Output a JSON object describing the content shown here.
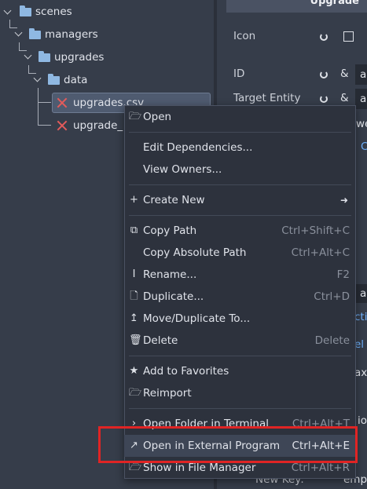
{
  "tree": {
    "items": [
      {
        "label": "scenes"
      },
      {
        "label": "managers"
      },
      {
        "label": "upgrades"
      },
      {
        "label": "data"
      },
      {
        "label": "upgrades.csv"
      },
      {
        "label": "upgrade_"
      }
    ]
  },
  "inspector": {
    "header": "Upgrade",
    "fields": [
      {
        "label": "Icon"
      },
      {
        "label": "ID",
        "value": "a"
      },
      {
        "label": "Target Entity",
        "value": "a"
      }
    ],
    "fragments": [
      "we",
      "C",
      "a",
      "ctio",
      "el",
      "ax",
      "io",
      "New Key:",
      "emp"
    ]
  },
  "menu": {
    "items": [
      {
        "label": "Open",
        "shortcut": "",
        "icon": "folder-open-icon"
      },
      {
        "label": "Edit Dependencies...",
        "shortcut": "",
        "icon": ""
      },
      {
        "label": "View Owners...",
        "shortcut": "",
        "icon": ""
      },
      {
        "label": "Create New",
        "shortcut": "",
        "icon": "plus-icon"
      },
      {
        "label": "Copy Path",
        "shortcut": "Ctrl+Shift+C",
        "icon": "copy-icon"
      },
      {
        "label": "Copy Absolute Path",
        "shortcut": "Ctrl+Alt+C",
        "icon": ""
      },
      {
        "label": "Rename...",
        "shortcut": "F2",
        "icon": "rename-icon"
      },
      {
        "label": "Duplicate...",
        "shortcut": "Ctrl+D",
        "icon": "duplicate-icon"
      },
      {
        "label": "Move/Duplicate To...",
        "shortcut": "",
        "icon": "move-icon"
      },
      {
        "label": "Delete",
        "shortcut": "Delete",
        "icon": "trash-icon"
      },
      {
        "label": "Add to Favorites",
        "shortcut": "",
        "icon": "star-icon"
      },
      {
        "label": "Reimport",
        "shortcut": "",
        "icon": "reimport-icon"
      },
      {
        "label": "Open Folder in Terminal",
        "shortcut": "Ctrl+Alt+T",
        "icon": "terminal-icon"
      },
      {
        "label": "Open in External Program",
        "shortcut": "Ctrl+Alt+E",
        "icon": "external-icon"
      },
      {
        "label": "Show in File Manager",
        "shortcut": "Ctrl+Alt+R",
        "icon": "filesystem-icon"
      }
    ]
  },
  "colors": {
    "highlight_box": "#e02424",
    "folder": "#8fb8e2",
    "error": "#e35b5b"
  }
}
